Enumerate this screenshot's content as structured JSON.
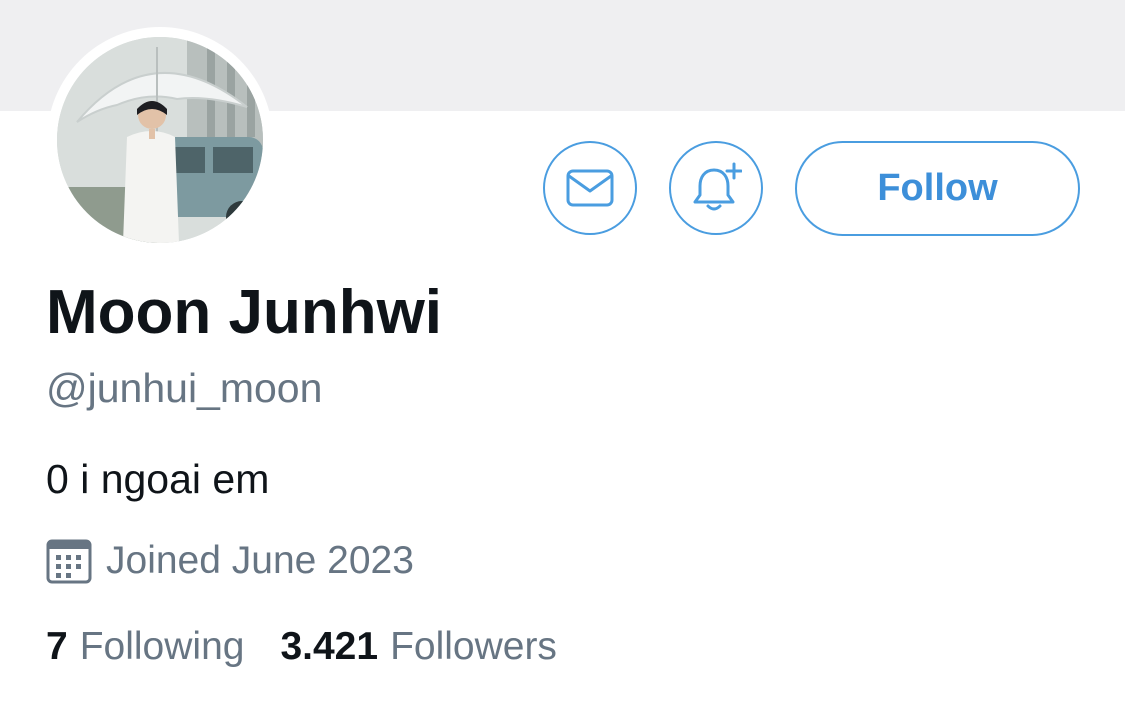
{
  "profile": {
    "display_name": "Moon Junhwi",
    "handle": "@junhui_moon",
    "bio": "0 i ngoai em",
    "joined": "Joined June 2023",
    "following_count": "7",
    "following_label": "Following",
    "followers_count": "3.421",
    "followers_label": "Followers"
  },
  "actions": {
    "message_icon": "envelope-icon",
    "notify_icon": "bell-plus-icon",
    "follow_label": "Follow"
  },
  "icons": {
    "calendar": "calendar-icon"
  },
  "colors": {
    "accent": "#4a9de0",
    "text_primary": "#0f1419",
    "text_secondary": "#677583",
    "banner": "#efeff1"
  }
}
